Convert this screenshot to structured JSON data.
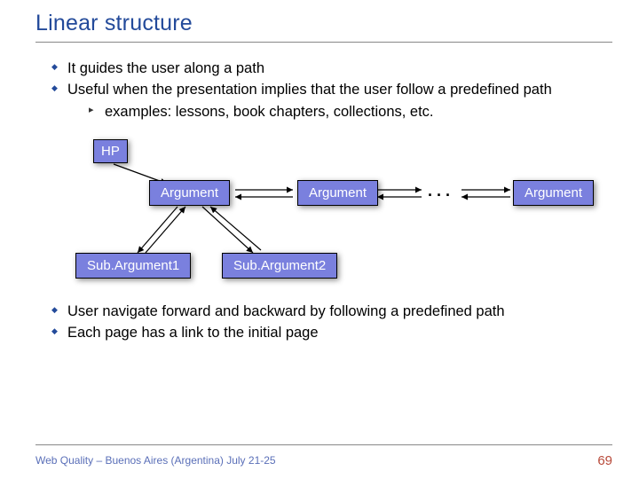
{
  "title": "Linear structure",
  "bullets_top": {
    "b1": "It guides the user along a path",
    "b2": "Useful when the presentation implies that the user follow a predefined path",
    "b2_sub1": "examples: lessons, book chapters, collections, etc."
  },
  "diagram": {
    "hp": "HP",
    "arg1": "Argument",
    "arg2": "Argument",
    "dots": ". . .",
    "arg3": "Argument",
    "sub1": "Sub.Argument1",
    "sub2": "Sub.Argument2"
  },
  "bullets_bottom": {
    "b1": "User navigate forward and backward by following a predefined path",
    "b2": "Each page has a link to the initial page"
  },
  "footer": {
    "left": "Web Quality – Buenos Aires (Argentina) July 21-25",
    "page": "69"
  }
}
